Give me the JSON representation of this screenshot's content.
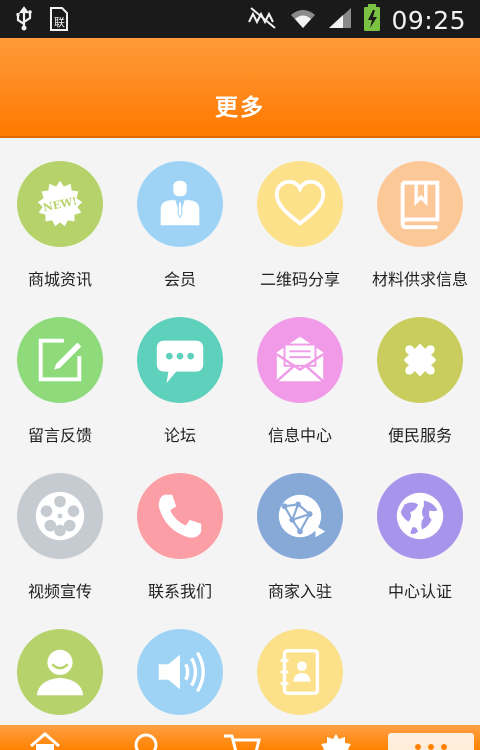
{
  "status_bar": {
    "time": "09:25",
    "left_icons": [
      "usb-icon",
      "sim-icon"
    ],
    "right_icons": [
      "mute-icon",
      "wifi-icon",
      "signal-icon",
      "battery-charging-icon"
    ]
  },
  "header": {
    "title": "更多"
  },
  "grid": {
    "items": [
      {
        "label": "商城资讯",
        "icon": "new-badge-icon",
        "color": "#b6d36b"
      },
      {
        "label": "会员",
        "icon": "member-icon",
        "color": "#9ed3f5"
      },
      {
        "label": "二维码分享",
        "icon": "heart-icon",
        "color": "#fde08a"
      },
      {
        "label": "材料供求信息",
        "icon": "book-icon",
        "color": "#fdc898"
      },
      {
        "label": "留言反馈",
        "icon": "note-pen-icon",
        "color": "#8fdb7c"
      },
      {
        "label": "论坛",
        "icon": "chat-bubble-icon",
        "color": "#5ed1bd"
      },
      {
        "label": "信息中心",
        "icon": "envelope-icon",
        "color": "#f09ae8"
      },
      {
        "label": "便民服务",
        "icon": "puzzle-icon",
        "color": "#c9cd5e"
      },
      {
        "label": "视频宣传",
        "icon": "film-reel-icon",
        "color": "#c6cbd2"
      },
      {
        "label": "联系我们",
        "icon": "phone-icon",
        "color": "#fb9ea5"
      },
      {
        "label": "商家入驻",
        "icon": "network-globe-icon",
        "color": "#87a9d8"
      },
      {
        "label": "中心认证",
        "icon": "globe-icon",
        "color": "#a795ec"
      },
      {
        "label": "",
        "icon": "user-icon",
        "color": "#b6d36b"
      },
      {
        "label": "",
        "icon": "speaker-icon",
        "color": "#9ed3f5"
      },
      {
        "label": "",
        "icon": "contacts-icon",
        "color": "#fde08a"
      }
    ]
  },
  "bottom_bar": {
    "items": [
      "home-icon",
      "search-icon",
      "cart-icon",
      "new-badge-icon",
      "more-icon"
    ]
  }
}
